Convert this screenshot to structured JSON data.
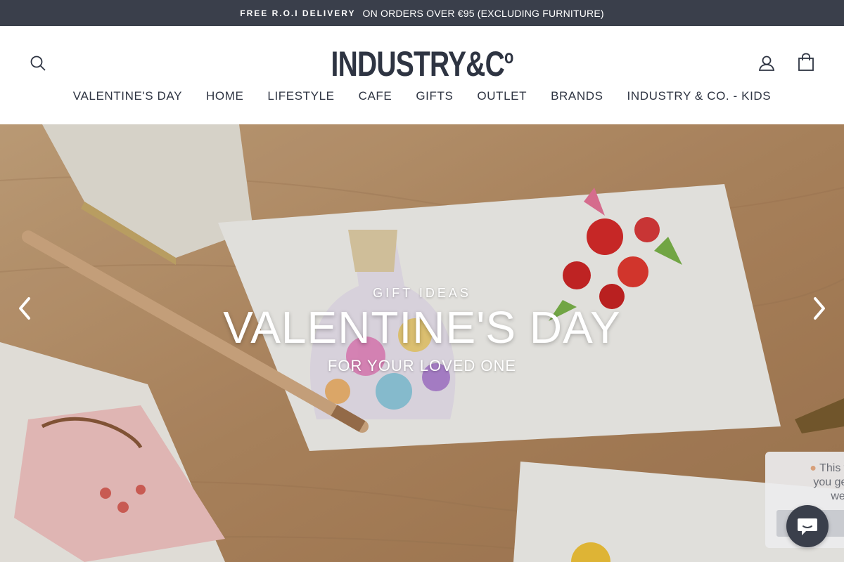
{
  "announcement": {
    "strong": "FREE R.O.I DELIVERY",
    "rest": "ON ORDERS OVER €95 (EXCLUDING FURNITURE)"
  },
  "header": {
    "logo_main": "INDUSTRY&C",
    "logo_sup": "o",
    "nav": [
      {
        "label": "VALENTINE'S DAY"
      },
      {
        "label": "HOME"
      },
      {
        "label": "LIFESTYLE"
      },
      {
        "label": "CAFE"
      },
      {
        "label": "GIFTS"
      },
      {
        "label": "OUTLET"
      },
      {
        "label": "BRANDS"
      },
      {
        "label": "INDUSTRY & CO. - KIDS"
      }
    ],
    "icons": {
      "search": "search-icon",
      "account": "user-icon",
      "cart": "shopping-bag-icon"
    }
  },
  "hero": {
    "eyebrow": "GIFT IDEAS",
    "headline": "VALENTINE'S DAY",
    "subline": "FOR YOUR LOVED ONE"
  },
  "notice": {
    "lines": [
      "This websi",
      "you get the",
      "web"
    ]
  },
  "colors": {
    "announcement_bg": "#3a3f4b",
    "brand_text": "#2e3442",
    "chat_bg": "#3a3f4b"
  }
}
